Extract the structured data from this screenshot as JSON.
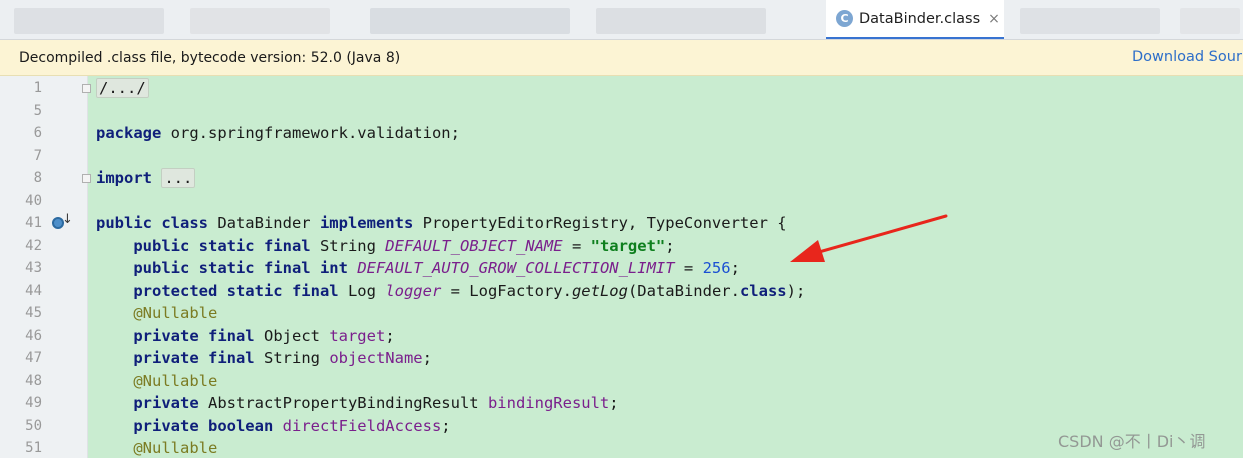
{
  "tabs": {
    "active": {
      "icon": "class-icon",
      "icon_letter": "C",
      "label": "DataBinder.class",
      "close": "×"
    }
  },
  "banner": {
    "text": "Decompiled .class file, bytecode version: 52.0 (Java 8)",
    "link": "Download Sour"
  },
  "editor": {
    "line_numbers": [
      "1",
      "5",
      "6",
      "7",
      "8",
      "40",
      "41",
      "42",
      "43",
      "44",
      "45",
      "46",
      "47",
      "48",
      "49",
      "50",
      "51"
    ],
    "gutter_icons": {
      "implements": "implements-icon",
      "implements_arrow": "↓"
    },
    "code": {
      "l1": "/.../",
      "l6_kw": "package",
      "l6_rest": " org.springframework.validation;",
      "l8_kw": "import",
      "l8_fold": "...",
      "l41_kw1": "public class",
      "l41_a": " DataBinder ",
      "l41_kw2": "implements",
      "l41_b": " PropertyEditorRegistry, TypeConverter {",
      "l42_kw": "public static final",
      "l42_type": " String ",
      "l42_const": "DEFAULT_OBJECT_NAME",
      "l42_eq": " = ",
      "l42_str": "\"target\"",
      "l42_end": ";",
      "l43_kw": "public static final int",
      "l43_sp": " ",
      "l43_const": "DEFAULT_AUTO_GROW_COLLECTION_LIMIT",
      "l43_eq": " = ",
      "l43_num": "256",
      "l43_end": ";",
      "l44_kw": "protected static final",
      "l44_type": " Log ",
      "l44_const": "logger",
      "l44_a": " = LogFactory.",
      "l44_mth": "getLog",
      "l44_b": "(DataBinder.",
      "l44_kw2": "class",
      "l44_c": ");",
      "l45_ann": "@Nullable",
      "l46_kw": "private final",
      "l46_type": " Object ",
      "l46_fld": "target",
      "l46_end": ";",
      "l47_kw": "private final",
      "l47_type": " String ",
      "l47_fld": "objectName",
      "l47_end": ";",
      "l48_ann": "@Nullable",
      "l49_kw": "private",
      "l49_type": " AbstractPropertyBindingResult ",
      "l49_fld": "bindingResult",
      "l49_end": ";",
      "l50_kw": "private boolean",
      "l50_sp": " ",
      "l50_fld": "directFieldAccess",
      "l50_end": ";",
      "l51_ann": "@Nullable"
    }
  },
  "annotation": {
    "arrow_color": "#e8261c"
  },
  "watermark": "CSDN @不丨Di丶调"
}
